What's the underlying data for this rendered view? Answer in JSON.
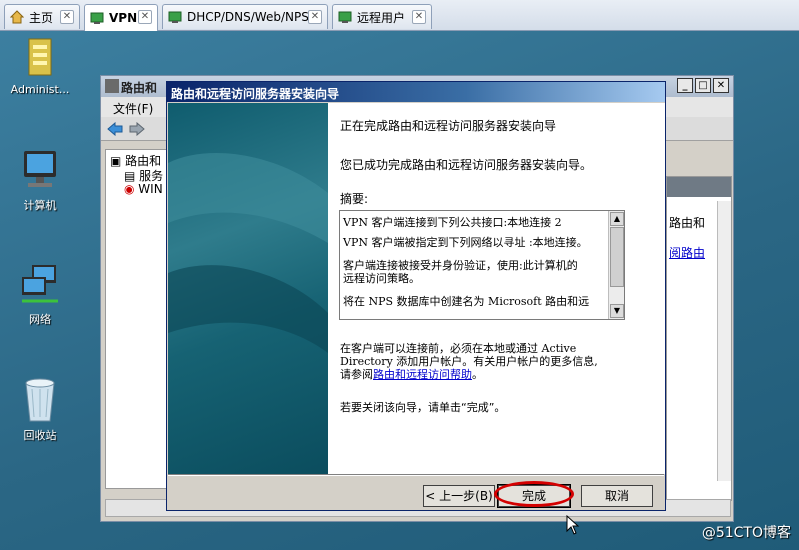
{
  "tabs": [
    {
      "label": "主页",
      "active": false
    },
    {
      "label": "VPN",
      "active": true
    },
    {
      "label": "DHCP/DNS/Web/NPS",
      "active": false
    },
    {
      "label": "远程用户",
      "active": false
    }
  ],
  "desktop_icons": [
    {
      "label": "Administ...",
      "icon": "folder-user-icon"
    },
    {
      "label": "计算机",
      "icon": "computer-icon"
    },
    {
      "label": "网络",
      "icon": "network-icon"
    },
    {
      "label": "回收站",
      "icon": "recycle-bin-icon"
    }
  ],
  "mmc": {
    "title": "路由和",
    "menu_file": "文件(F)",
    "tree": [
      "路由和",
      "服务",
      "WIN"
    ],
    "right_text": "路由和",
    "right_link": "阅路由"
  },
  "wizard": {
    "title": "路由和远程访问服务器安装向导",
    "heading": "正在完成路由和远程访问服务器安装向导",
    "success": "您已成功完成路由和远程访问服务器安装向导。",
    "summary_label": "摘要:",
    "summary_lines": [
      "VPN 客户端连接到下列公共接口:本地连接 2",
      "VPN 客户端被指定到下列网络以寻址 :本地连接。",
      "客户端连接被接受并身份验证，使用:此计算机的",
      "远程访问策略。",
      "将在 NPS 数据库中创建名为 Microsoft 路由和远"
    ],
    "info_line1": "在客户端可以连接前，必须在本地或通过 Active",
    "info_line2": "Directory 添加用户帐户。有关用户帐户的更多信息,",
    "info_line3_pre": "请参阅",
    "info_line3_link": "路由和远程访问帮助",
    "info_line3_post": "。",
    "close_hint": "若要关闭该向导，请单击“完成”。",
    "btn_back": "< 上一步(B)",
    "btn_finish": "完成",
    "btn_cancel": "取消"
  },
  "watermark": "@51CTO博客"
}
